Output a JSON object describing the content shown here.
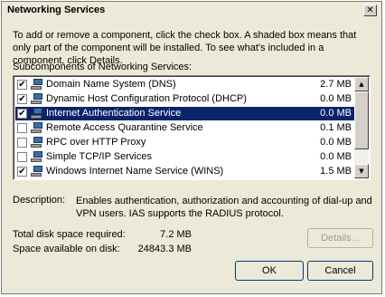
{
  "window": {
    "title": "Networking Services",
    "close_glyph": "✕"
  },
  "intro_text": "To add or remove a component, click the check box. A shaded box means that only part of the component will be installed. To see what's included in a component, click Details.",
  "subcomponents_label": "Subcomponents of Networking Services:",
  "items": [
    {
      "name": "Domain Name System (DNS)",
      "size": "2.7 MB",
      "checked": true,
      "selected": false
    },
    {
      "name": "Dynamic Host Configuration Protocol (DHCP)",
      "size": "0.0 MB",
      "checked": true,
      "selected": false
    },
    {
      "name": "Internet Authentication Service",
      "size": "0.0 MB",
      "checked": true,
      "selected": true
    },
    {
      "name": "Remote Access Quarantine Service",
      "size": "0.1 MB",
      "checked": false,
      "selected": false
    },
    {
      "name": "RPC over HTTP Proxy",
      "size": "0.0 MB",
      "checked": false,
      "selected": false
    },
    {
      "name": "Simple TCP/IP Services",
      "size": "0.0 MB",
      "checked": false,
      "selected": false
    },
    {
      "name": "Windows Internet Name Service (WINS)",
      "size": "1.5 MB",
      "checked": true,
      "selected": false
    }
  ],
  "description": {
    "label": "Description:",
    "text": "Enables authentication, authorization and accounting of dial-up and VPN users. IAS supports the RADIUS protocol."
  },
  "disk": {
    "required_label": "Total disk space required:",
    "required_value": "7.2 MB",
    "available_label": "Space available on disk:",
    "available_value": "24843.3 MB"
  },
  "buttons": {
    "details": "Details...",
    "ok": "OK",
    "cancel": "Cancel"
  },
  "colors": {
    "selection": "#0a246a",
    "dialog_bg": "#ece9d8"
  }
}
